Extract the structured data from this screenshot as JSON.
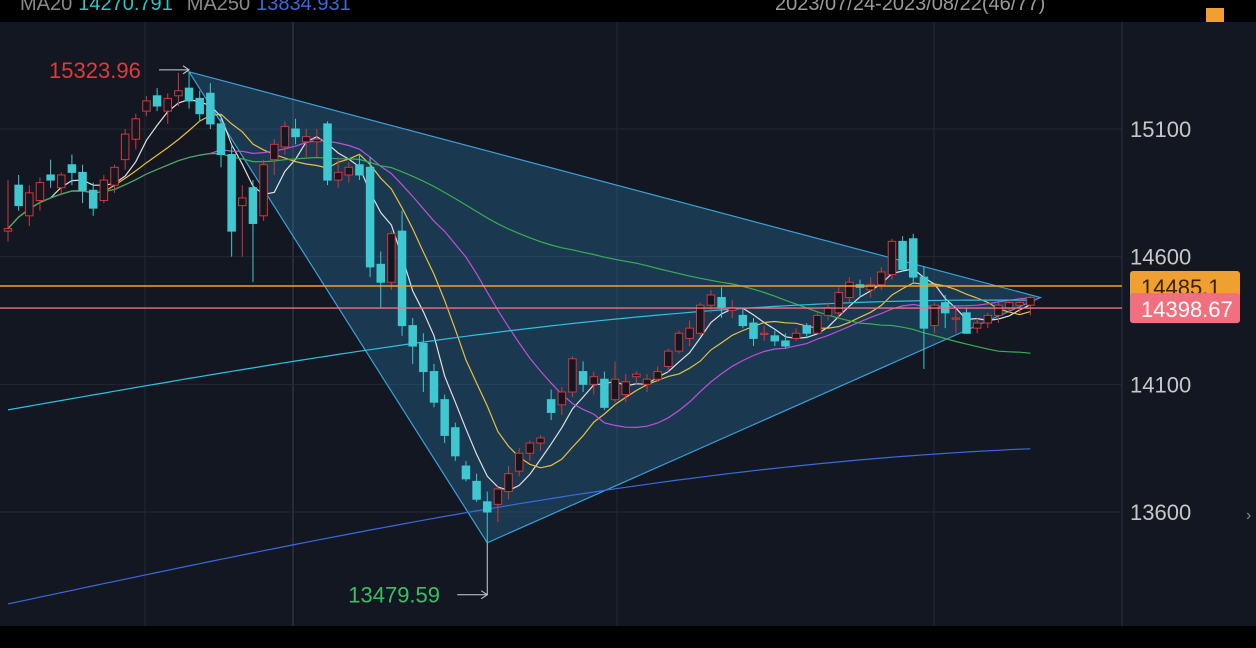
{
  "legend": {
    "items": [
      {
        "label": "MA20",
        "value": "14270.791",
        "color": "#2ec4c4"
      },
      {
        "label": "MA250",
        "value": "13834.931",
        "color": "#3a6ae0"
      }
    ]
  },
  "date_range": "2023/07/24-2023/08/22(46/77)",
  "colors": {
    "background": "#131722",
    "up": "#d03838",
    "down": "#40c8d0",
    "triangle_fill": "#2d7fae",
    "triangle_edge": "#3aa0d8",
    "orange_line": "#f0a030",
    "pink_line": "#f07080"
  },
  "chart_data": {
    "type": "candlestick",
    "ylim": [
      13100,
      15500
    ],
    "y_ticks": [
      13600,
      14100,
      14600,
      15100
    ],
    "high_marker": {
      "label": "15323.96",
      "value": 15323.96
    },
    "low_marker": {
      "label": "13479.59",
      "value": 13479.59
    },
    "price_tags": [
      {
        "label": "14485.1",
        "value": 14485.1,
        "color": "#f0a030"
      },
      {
        "label": "14398.67",
        "value": 14398.67,
        "color": "#f07080"
      }
    ],
    "triangle": {
      "apex_high": 15323.96,
      "apex_low": 13479.59,
      "right_tip": 14440
    },
    "candles": [
      [
        14700,
        14900,
        14660,
        14710
      ],
      [
        14880,
        14920,
        14780,
        14800
      ],
      [
        14760,
        14880,
        14720,
        14850
      ],
      [
        14820,
        14910,
        14780,
        14890
      ],
      [
        14920,
        14980,
        14870,
        14900
      ],
      [
        14870,
        14930,
        14840,
        14920
      ],
      [
        14960,
        15000,
        14880,
        14930
      ],
      [
        14930,
        14960,
        14810,
        14860
      ],
      [
        14860,
        14890,
        14760,
        14790
      ],
      [
        14820,
        14920,
        14810,
        14900
      ],
      [
        14880,
        14960,
        14850,
        14950
      ],
      [
        14980,
        15100,
        14940,
        15080
      ],
      [
        15060,
        15160,
        15020,
        15140
      ],
      [
        15170,
        15230,
        15150,
        15210
      ],
      [
        15230,
        15260,
        15170,
        15190
      ],
      [
        15170,
        15240,
        15120,
        15220
      ],
      [
        15230,
        15320,
        15190,
        15250
      ],
      [
        15260,
        15323.96,
        15180,
        15210
      ],
      [
        15220,
        15250,
        15130,
        15160
      ],
      [
        15240,
        15280,
        15100,
        15120
      ],
      [
        15120,
        15160,
        14950,
        15000
      ],
      [
        15000,
        15040,
        14600,
        14700
      ],
      [
        14800,
        14880,
        14600,
        14830
      ],
      [
        14870,
        14900,
        14500,
        14730
      ],
      [
        14760,
        14980,
        14740,
        14960
      ],
      [
        14980,
        15060,
        14920,
        15040
      ],
      [
        15030,
        15130,
        15000,
        15110
      ],
      [
        15100,
        15140,
        15040,
        15070
      ],
      [
        15050,
        15100,
        14990,
        15070
      ],
      [
        15050,
        15100,
        14990,
        15060
      ],
      [
        15120,
        15130,
        14880,
        14900
      ],
      [
        14900,
        14990,
        14870,
        14930
      ],
      [
        14920,
        14970,
        14890,
        14950
      ],
      [
        14960,
        15000,
        14900,
        14920
      ],
      [
        14950,
        14990,
        14520,
        14560
      ],
      [
        14570,
        14620,
        14400,
        14500
      ],
      [
        14500,
        14700,
        14470,
        14690
      ],
      [
        14700,
        14780,
        14290,
        14330
      ],
      [
        14330,
        14360,
        14180,
        14250
      ],
      [
        14260,
        14300,
        14070,
        14150
      ],
      [
        14150,
        14180,
        14010,
        14030
      ],
      [
        14040,
        14060,
        13870,
        13900
      ],
      [
        13930,
        13950,
        13800,
        13820
      ],
      [
        13780,
        13800,
        13720,
        13730
      ],
      [
        13720,
        13750,
        13640,
        13650
      ],
      [
        13640,
        13680,
        13479.59,
        13600
      ],
      [
        13630,
        13700,
        13560,
        13690
      ],
      [
        13680,
        13780,
        13650,
        13750
      ],
      [
        13760,
        13850,
        13740,
        13830
      ],
      [
        13830,
        13880,
        13800,
        13870
      ],
      [
        13870,
        13900,
        13840,
        13890
      ],
      [
        14040,
        14080,
        13960,
        13990
      ],
      [
        14020,
        14090,
        13980,
        14070
      ],
      [
        14070,
        14210,
        14050,
        14200
      ],
      [
        14150,
        14190,
        14070,
        14100
      ],
      [
        14100,
        14150,
        14060,
        14130
      ],
      [
        14120,
        14150,
        14000,
        14010
      ],
      [
        14040,
        14190,
        14030,
        14120
      ],
      [
        14060,
        14140,
        14030,
        14110
      ],
      [
        14130,
        14150,
        14100,
        14140
      ],
      [
        14100,
        14140,
        14070,
        14120
      ],
      [
        14120,
        14170,
        14110,
        14150
      ],
      [
        14170,
        14240,
        14150,
        14230
      ],
      [
        14230,
        14310,
        14220,
        14300
      ],
      [
        14280,
        14350,
        14250,
        14320
      ],
      [
        14300,
        14420,
        14290,
        14410
      ],
      [
        14410,
        14470,
        14380,
        14450
      ],
      [
        14440,
        14480,
        14360,
        14400
      ],
      [
        14390,
        14430,
        14360,
        14400
      ],
      [
        14370,
        14400,
        14320,
        14330
      ],
      [
        14340,
        14360,
        14250,
        14280
      ],
      [
        14300,
        14330,
        14270,
        14300
      ],
      [
        14290,
        14310,
        14250,
        14270
      ],
      [
        14270,
        14300,
        14240,
        14250
      ],
      [
        14280,
        14320,
        14270,
        14300
      ],
      [
        14330,
        14340,
        14280,
        14300
      ],
      [
        14300,
        14380,
        14300,
        14370
      ],
      [
        14370,
        14420,
        14350,
        14400
      ],
      [
        14380,
        14480,
        14360,
        14460
      ],
      [
        14440,
        14520,
        14420,
        14500
      ],
      [
        14490,
        14510,
        14440,
        14480
      ],
      [
        14470,
        14520,
        14440,
        14490
      ],
      [
        14490,
        14560,
        14470,
        14540
      ],
      [
        14530,
        14670,
        14510,
        14660
      ],
      [
        14660,
        14680,
        14540,
        14550
      ],
      [
        14670,
        14690,
        14500,
        14520
      ],
      [
        14520,
        14560,
        14160,
        14320
      ],
      [
        14330,
        14420,
        14300,
        14410
      ],
      [
        14420,
        14450,
        14320,
        14380
      ],
      [
        14360,
        14400,
        14300,
        14360
      ],
      [
        14380,
        14400,
        14300,
        14300
      ],
      [
        14320,
        14360,
        14300,
        14340
      ],
      [
        14340,
        14380,
        14320,
        14370
      ],
      [
        14370,
        14420,
        14340,
        14410
      ],
      [
        14400,
        14430,
        14380,
        14420
      ],
      [
        14410,
        14440,
        14380,
        14420
      ],
      [
        14410,
        14450,
        14370,
        14440
      ]
    ]
  }
}
